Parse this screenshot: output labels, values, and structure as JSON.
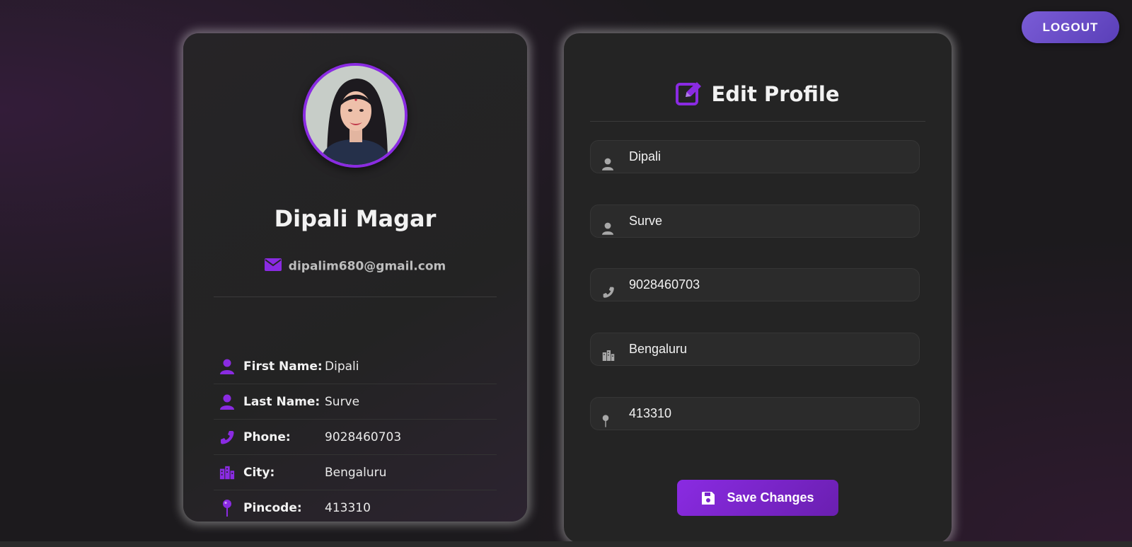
{
  "header": {
    "logout_label": "LOGOUT"
  },
  "profile": {
    "name": "Dipali Magar",
    "email": "dipalim680@gmail.com",
    "details": [
      {
        "icon": "user-icon",
        "label": "First Name:",
        "value": "Dipali"
      },
      {
        "icon": "user-icon",
        "label": "Last Name:",
        "value": "Surve"
      },
      {
        "icon": "phone-icon",
        "label": "Phone:",
        "value": "9028460703"
      },
      {
        "icon": "city-icon",
        "label": "City:",
        "value": "Bengaluru"
      },
      {
        "icon": "pin-icon",
        "label": "Pincode:",
        "value": "413310"
      }
    ]
  },
  "edit": {
    "title": "Edit Profile",
    "fields": {
      "first_name": "Dipali",
      "last_name": "Surve",
      "phone": "9028460703",
      "city": "Bengaluru",
      "pincode": "413310"
    },
    "save_label": "Save Changes"
  },
  "colors": {
    "accent": "#8a2be2",
    "logout": "#6a4fc8",
    "card": "#242424",
    "background": "#1c1a1d"
  }
}
